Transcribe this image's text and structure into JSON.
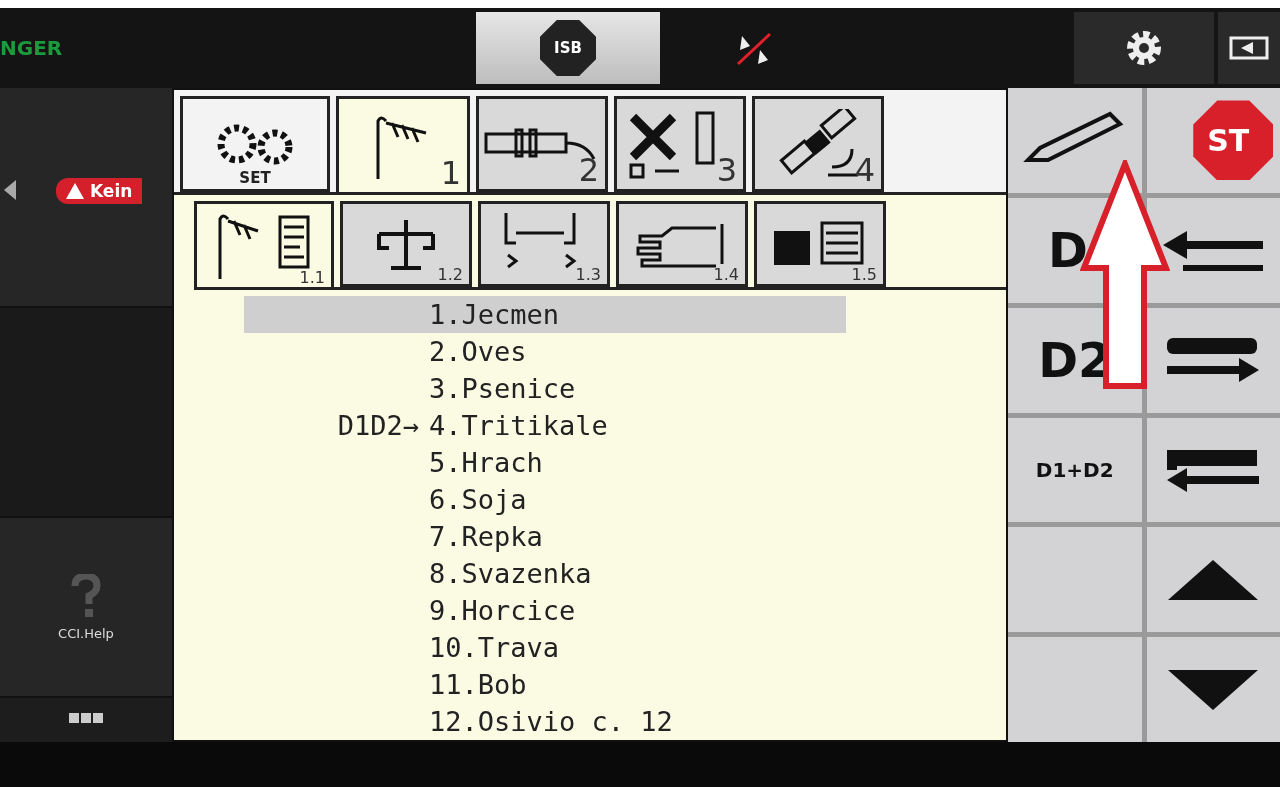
{
  "top_bar": {
    "brand": "NGER",
    "isb_label": "ISB"
  },
  "left_panel": {
    "alert": "Kein",
    "help_label": "CCI.Help"
  },
  "main_tabs": [
    {
      "kind": "set",
      "label": "SET",
      "selected": false
    },
    {
      "kind": "crop",
      "label": "1",
      "selected": true
    },
    {
      "kind": "sensor",
      "label": "2",
      "selected": false
    },
    {
      "kind": "tools",
      "label": "3",
      "selected": false
    },
    {
      "kind": "satellite",
      "label": "4",
      "selected": false
    }
  ],
  "sub_tabs": [
    {
      "kind": "crop-list",
      "label": "1.1",
      "selected": true
    },
    {
      "kind": "scale",
      "label": "1.2",
      "selected": false
    },
    {
      "kind": "coulter",
      "label": "1.3",
      "selected": false
    },
    {
      "kind": "hand",
      "label": "1.4",
      "selected": false
    },
    {
      "kind": "weight",
      "label": "1.5",
      "selected": false
    }
  ],
  "crops": [
    {
      "name": "1.Jecmen",
      "selected": true
    },
    {
      "name": "2.Oves",
      "selected": false
    },
    {
      "name": "3.Psenice",
      "selected": false
    },
    {
      "name": "4.Tritikale",
      "selected": false,
      "marker": "D1D2→"
    },
    {
      "name": "5.Hrach",
      "selected": false
    },
    {
      "name": "6.Soja",
      "selected": false
    },
    {
      "name": "7.Repka",
      "selected": false
    },
    {
      "name": "8.Svazenka",
      "selected": false
    },
    {
      "name": "9.Horcice",
      "selected": false
    },
    {
      "name": "10.Trava",
      "selected": false
    },
    {
      "name": "11.Bob",
      "selected": false
    },
    {
      "name": "12.Osivio c. 12",
      "selected": false
    }
  ],
  "soft_keys": [
    {
      "kind": "pencil"
    },
    {
      "kind": "stop",
      "label": "ST"
    },
    {
      "kind": "text",
      "label": "D"
    },
    {
      "kind": "arrow-left"
    },
    {
      "kind": "text",
      "label": "D2"
    },
    {
      "kind": "fill-right"
    },
    {
      "kind": "small-text",
      "label": "D1+D2"
    },
    {
      "kind": "empty-left"
    },
    {
      "kind": "blank"
    },
    {
      "kind": "up"
    },
    {
      "kind": "blank"
    },
    {
      "kind": "down"
    }
  ]
}
